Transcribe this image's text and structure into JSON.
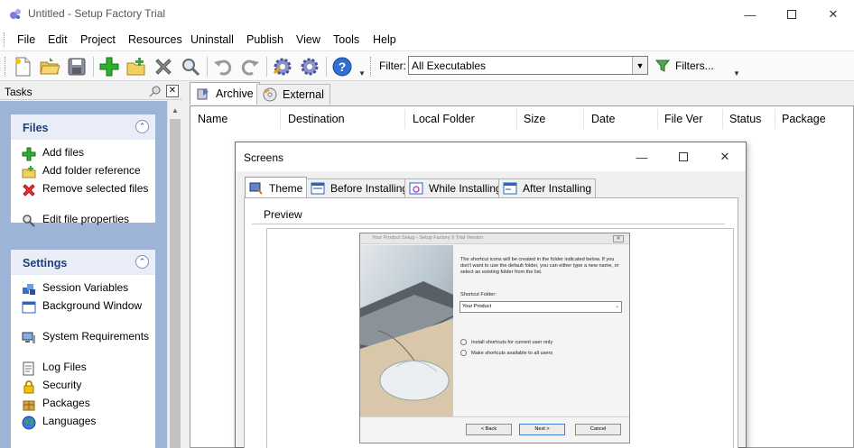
{
  "window": {
    "title": "Untitled - Setup Factory Trial",
    "controls": [
      "minimize",
      "maximize",
      "close"
    ]
  },
  "menu": [
    "File",
    "Edit",
    "Project",
    "Resources",
    "Uninstall",
    "Publish",
    "View",
    "Tools",
    "Help"
  ],
  "toolbar": {
    "buttons": [
      "new-project-icon",
      "open-project-icon",
      "save-icon",
      "add-files-icon",
      "add-folder-icon",
      "remove-icon",
      "properties-icon",
      "undo-icon",
      "redo-icon",
      "build-icon",
      "publish-icon",
      "help-icon"
    ],
    "filter_label": "Filter:",
    "filter_value": "All Executables",
    "filters_button": "Filters..."
  },
  "tasks": {
    "title": "Tasks",
    "files": {
      "title": "Files",
      "items": [
        "Add files",
        "Add folder reference",
        "Remove selected files",
        "Edit file properties"
      ]
    },
    "settings": {
      "title": "Settings",
      "items": [
        "Session Variables",
        "Background Window",
        "System Requirements",
        "Log Files",
        "Security",
        "Packages",
        "Languages"
      ]
    }
  },
  "tabs": [
    {
      "label": "Archive",
      "active": true
    },
    {
      "label": "External",
      "active": false
    }
  ],
  "columns": [
    "Name",
    "Destination",
    "Local Folder",
    "Size",
    "Date",
    "File Ver",
    "Status",
    "Package"
  ],
  "dialog": {
    "title": "Screens",
    "tabs": [
      "Theme",
      "Before Installing",
      "While Installing",
      "After Installing"
    ],
    "active_tab": "Theme",
    "preview_label": "Preview",
    "preview": {
      "title": "Your Product Setup - Setup Factory 9 Trial Version",
      "description": "The shortcut icons will be created in the folder indicated below. If you don't want to use the default folder, you can either type a new name, or select an existing folder from the list.",
      "folder_label": "Shortcut Folder:",
      "folder_value": "Your Product",
      "radio1": "Install shortcuts for current user only",
      "radio2": "Make shortcuts available to all users",
      "back": "< Back",
      "next": "Next >",
      "cancel": "Cancel"
    }
  },
  "colors": {
    "task_pane_bg": "#9eb4d6",
    "group_title": "#1f3f7a",
    "accent": "#3c7fd1"
  }
}
